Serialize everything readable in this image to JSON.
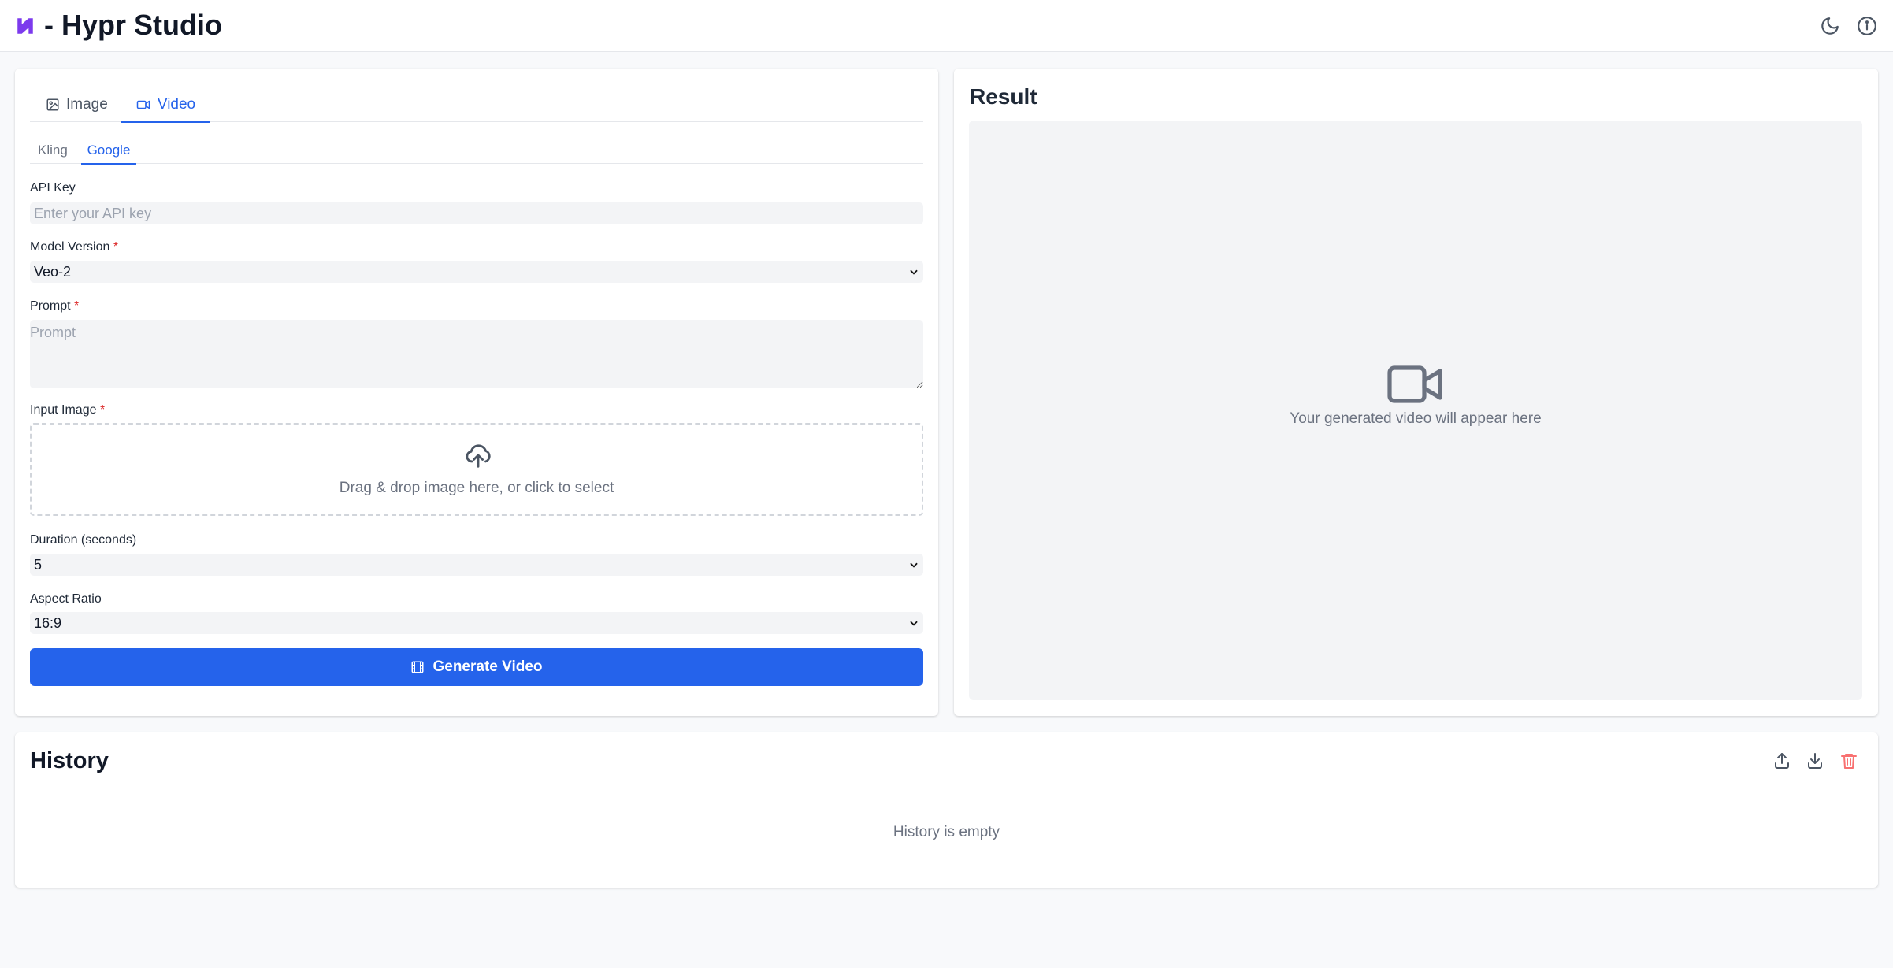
{
  "header": {
    "title": "- Hypr Studio",
    "logo_color": "#7c3aed",
    "icons": [
      "moon-icon",
      "info-icon"
    ]
  },
  "left_panel": {
    "tabs": [
      {
        "label": "Image",
        "icon": "image-icon",
        "active": false
      },
      {
        "label": "Video",
        "icon": "video-icon",
        "active": true
      }
    ],
    "subtabs": [
      {
        "label": "Kling",
        "active": false
      },
      {
        "label": "Google",
        "active": true
      }
    ],
    "api_key": {
      "label": "API Key",
      "placeholder": "Enter your API key",
      "value": ""
    },
    "model_version": {
      "label": "Model Version",
      "required": "*",
      "value": "Veo-2"
    },
    "prompt": {
      "label": "Prompt",
      "required": "*",
      "placeholder": "Prompt",
      "value": ""
    },
    "input_image": {
      "label": "Input Image",
      "required": "*",
      "dropzone_text": "Drag & drop image here, or click to select"
    },
    "duration": {
      "label": "Duration (seconds)",
      "value": "5"
    },
    "aspect_ratio": {
      "label": "Aspect Ratio",
      "value": "16:9"
    },
    "generate_button": {
      "label": "Generate Video",
      "icon": "film-icon"
    }
  },
  "result": {
    "title": "Result",
    "placeholder_text": "Your generated video will appear here",
    "icon": "video-camera-icon"
  },
  "history": {
    "title": "History",
    "empty_text": "History is empty",
    "actions": [
      "export-icon",
      "import-icon",
      "trash-icon"
    ]
  },
  "colors": {
    "accent": "#2563eb",
    "danger": "#f87171",
    "page_bg": "#f8f9fb"
  }
}
